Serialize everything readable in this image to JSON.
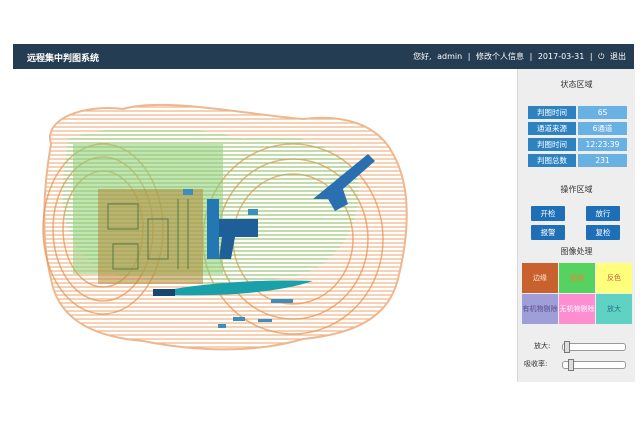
{
  "header": {
    "title": "远程集中判图系统",
    "greeting": "您好,",
    "username": "admin",
    "separator1": "|",
    "change_info": "修改个人信息",
    "separator2": "|",
    "date": "2017-03-31",
    "separator3": "|",
    "logout": "退出",
    "logout_icon": "power-icon"
  },
  "status": {
    "title": "状态区域",
    "rows": [
      {
        "label": "判图时间",
        "value": "6S"
      },
      {
        "label": "通道来源",
        "value": "6通道"
      },
      {
        "label": "判图时间",
        "value": "12:23:39"
      },
      {
        "label": "判图总数",
        "value": "231"
      }
    ]
  },
  "operations": {
    "title": "操作区域",
    "buttons": [
      "开检",
      "放行",
      "报警",
      "复检"
    ]
  },
  "processing": {
    "title": "图像处理",
    "tiles": [
      {
        "label": "边缘",
        "bg": "#c8612e",
        "fg": "#ffe7c8"
      },
      {
        "label": "超增",
        "bg": "#55d25f",
        "fg": "#ff7b3a"
      },
      {
        "label": "反色",
        "bg": "#ffff7c",
        "fg": "#c45a3a"
      },
      {
        "label": "有机物剔除",
        "bg": "#9f9ed8",
        "fg": "#5a4f8f"
      },
      {
        "label": "无机物剔除",
        "bg": "#ff8ed1",
        "fg": "#ffffff"
      },
      {
        "label": "放大",
        "bg": "#5fd2c4",
        "fg": "#2e6f8f"
      }
    ],
    "zoom_label": "放大:",
    "absorb_label": "吸收率:"
  },
  "colors": {
    "topbar": "#243d52",
    "stat_key": "#2d83c2",
    "stat_value": "#6ab1e3",
    "button": "#1e6fb5"
  }
}
